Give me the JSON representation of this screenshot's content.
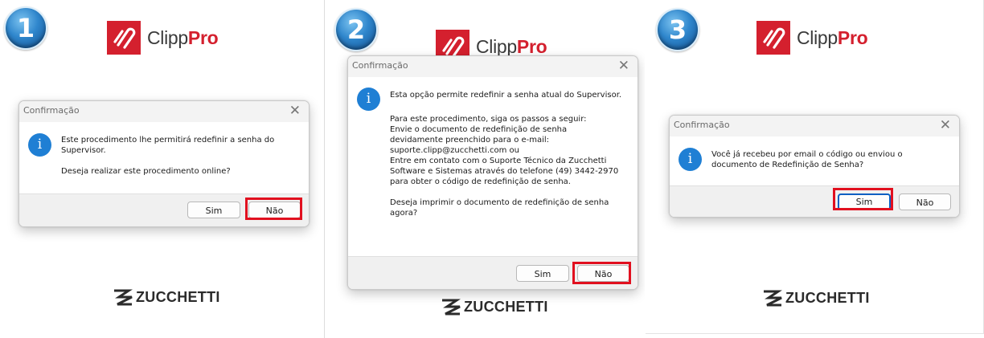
{
  "logo": {
    "text_light": "Clipp",
    "text_bold": "Pro"
  },
  "footer_logo": {
    "text": "ZUCCHETTI"
  },
  "steps": [
    "1",
    "2",
    "3"
  ],
  "panels": [
    {
      "dialog": {
        "title": "Confirmação",
        "close": "✕",
        "message": "Este procedimento lhe permitirá redefinir a senha do\nSupervisor.\n\nDeseja realizar este procedimento online?",
        "yes": "Sim",
        "no": "Não",
        "highlighted": "Não"
      }
    },
    {
      "dialog": {
        "title": "Confirmação",
        "close": "✕",
        "message_intro": "Esta opção permite redefinir a senha atual do Supervisor.",
        "message": "Para este procedimento, siga os passos a seguir:\nEnvie o documento de redefinição de senha\ndevidamente preenchido para o e-mail:\nsuporte.clipp@zucchetti.com ou\nEntre em contato com o Suporte Técnico da Zucchetti\nSoftware e Sistemas através do telefone (49) 3442-2970\npara obter o código de redefinição de senha.\n\nDeseja imprimir o documento de redefinição de senha\nagora?",
        "yes": "Sim",
        "no": "Não",
        "highlighted": "Não"
      }
    },
    {
      "dialog": {
        "title": "Confirmação",
        "close": "✕",
        "message": "Você já recebeu por email o código ou enviou o\ndocumento de Redefinição de Senha?",
        "yes": "Sim",
        "no": "Não",
        "highlighted": "Sim"
      }
    }
  ],
  "colors": {
    "brand_red": "#d4202e",
    "highlight_red": "#e1101f",
    "info_blue": "#1f7fd4",
    "step_blue": "#2f86cc"
  },
  "icons": [
    "clipppro-logo-icon",
    "zucchetti-logo-icon",
    "info-icon",
    "close-icon"
  ]
}
